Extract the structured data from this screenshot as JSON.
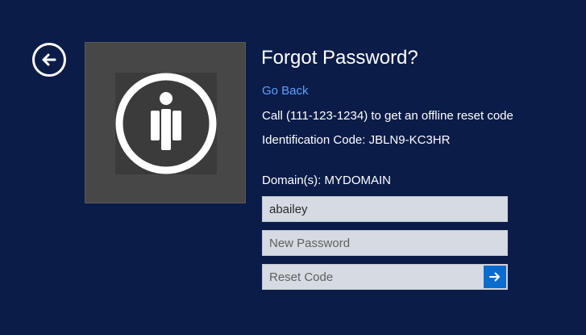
{
  "colors": {
    "background": "#0b1c48",
    "tile": "#474747",
    "link": "#5aa0ff",
    "field": "#d6dae2",
    "submit": "#0a6ccf"
  },
  "back_button": {
    "icon": "left-arrow-circle-icon"
  },
  "user_tile": {
    "icon": "user-silhouette-icon"
  },
  "form": {
    "title": "Forgot Password?",
    "go_back_label": "Go Back",
    "call_text": "Call (111-123-1234) to get an offline reset code",
    "identification_text": "Identification Code: JBLN9-KC3HR",
    "domain_text": "Domain(s): MYDOMAIN",
    "username_value": "abailey",
    "new_password_placeholder": "New Password",
    "reset_code_placeholder": "Reset Code",
    "submit_icon": "right-arrow-icon"
  }
}
